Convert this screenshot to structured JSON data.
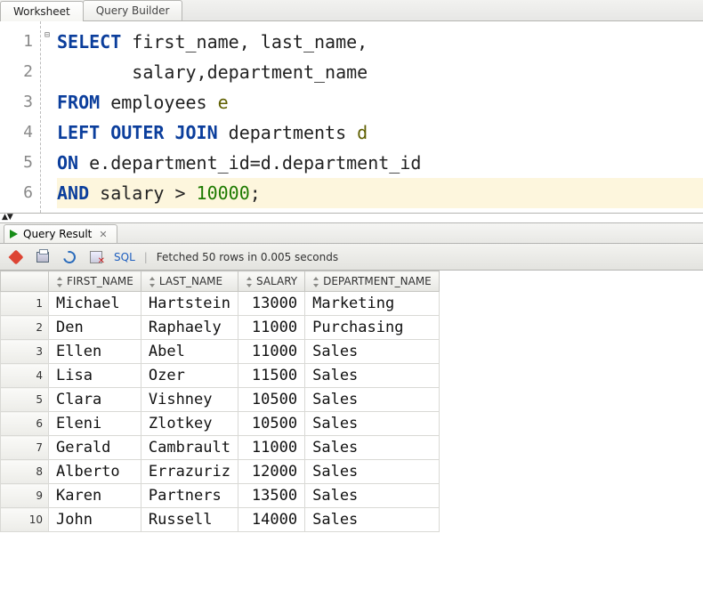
{
  "tabs": {
    "worksheet": "Worksheet",
    "query_builder": "Query Builder"
  },
  "editor": {
    "fold_glyph": "⊟",
    "lines": [
      [
        {
          "t": "SELECT",
          "c": "kw"
        },
        {
          "t": " first_name, last_name,",
          "c": "ident"
        }
      ],
      [
        {
          "t": "       salary,department_name",
          "c": "ident"
        }
      ],
      [
        {
          "t": "FROM",
          "c": "kw"
        },
        {
          "t": " employees ",
          "c": "ident"
        },
        {
          "t": "e",
          "c": "al"
        }
      ],
      [
        {
          "t": "LEFT OUTER JOIN",
          "c": "kw"
        },
        {
          "t": " departments ",
          "c": "ident"
        },
        {
          "t": "d",
          "c": "al"
        }
      ],
      [
        {
          "t": "ON",
          "c": "kw"
        },
        {
          "t": " e.department_id=d.department_id",
          "c": "ident"
        }
      ],
      [
        {
          "t": "AND",
          "c": "kw"
        },
        {
          "t": " salary > ",
          "c": "ident"
        },
        {
          "t": "10000",
          "c": "num"
        },
        {
          "t": ";",
          "c": "punct"
        }
      ]
    ],
    "highlight_line_index": 5
  },
  "result_tab": {
    "label": "Query Result",
    "close_glyph": "✕"
  },
  "toolbar": {
    "sql_link": "SQL",
    "separator": "|",
    "status": "Fetched 50 rows in 0.005 seconds"
  },
  "grid": {
    "columns": [
      "FIRST_NAME",
      "LAST_NAME",
      "SALARY",
      "DEPARTMENT_NAME"
    ],
    "numeric_columns": [
      "SALARY"
    ],
    "rows": [
      {
        "FIRST_NAME": "Michael",
        "LAST_NAME": "Hartstein",
        "SALARY": "13000",
        "DEPARTMENT_NAME": "Marketing"
      },
      {
        "FIRST_NAME": "Den",
        "LAST_NAME": "Raphaely",
        "SALARY": "11000",
        "DEPARTMENT_NAME": "Purchasing"
      },
      {
        "FIRST_NAME": "Ellen",
        "LAST_NAME": "Abel",
        "SALARY": "11000",
        "DEPARTMENT_NAME": "Sales"
      },
      {
        "FIRST_NAME": "Lisa",
        "LAST_NAME": "Ozer",
        "SALARY": "11500",
        "DEPARTMENT_NAME": "Sales"
      },
      {
        "FIRST_NAME": "Clara",
        "LAST_NAME": "Vishney",
        "SALARY": "10500",
        "DEPARTMENT_NAME": "Sales"
      },
      {
        "FIRST_NAME": "Eleni",
        "LAST_NAME": "Zlotkey",
        "SALARY": "10500",
        "DEPARTMENT_NAME": "Sales"
      },
      {
        "FIRST_NAME": "Gerald",
        "LAST_NAME": "Cambrault",
        "SALARY": "11000",
        "DEPARTMENT_NAME": "Sales"
      },
      {
        "FIRST_NAME": "Alberto",
        "LAST_NAME": "Errazuriz",
        "SALARY": "12000",
        "DEPARTMENT_NAME": "Sales"
      },
      {
        "FIRST_NAME": "Karen",
        "LAST_NAME": "Partners",
        "SALARY": "13500",
        "DEPARTMENT_NAME": "Sales"
      },
      {
        "FIRST_NAME": "John",
        "LAST_NAME": "Russell",
        "SALARY": "14000",
        "DEPARTMENT_NAME": "Sales"
      }
    ]
  }
}
